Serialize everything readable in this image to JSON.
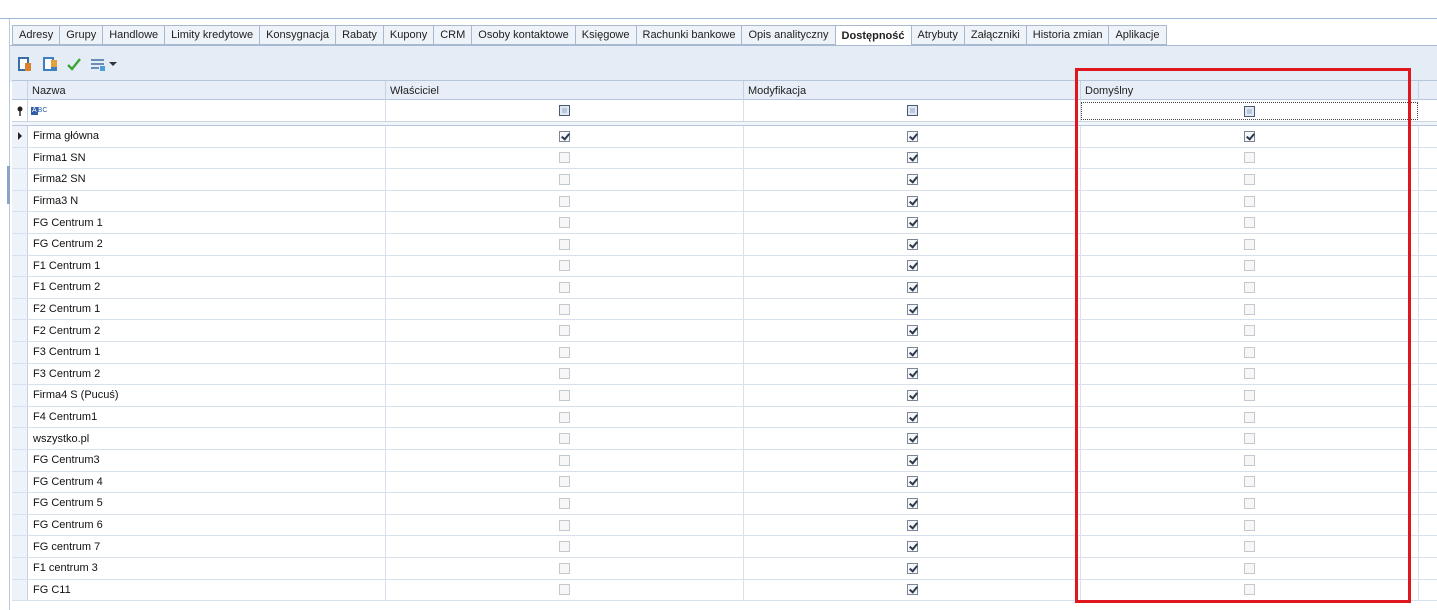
{
  "tabs": [
    {
      "label": "Adresy",
      "active": false
    },
    {
      "label": "Grupy",
      "active": false
    },
    {
      "label": "Handlowe",
      "active": false
    },
    {
      "label": "Limity kredytowe",
      "active": false
    },
    {
      "label": "Konsygnacja",
      "active": false
    },
    {
      "label": "Rabaty",
      "active": false
    },
    {
      "label": "Kupony",
      "active": false
    },
    {
      "label": "CRM",
      "active": false
    },
    {
      "label": "Osoby kontaktowe",
      "active": false
    },
    {
      "label": "Księgowe",
      "active": false
    },
    {
      "label": "Rachunki bankowe",
      "active": false
    },
    {
      "label": "Opis analityczny",
      "active": false
    },
    {
      "label": "Dostępność",
      "active": true
    },
    {
      "label": "Atrybuty",
      "active": false
    },
    {
      "label": "Załączniki",
      "active": false
    },
    {
      "label": "Historia zmian",
      "active": false
    },
    {
      "label": "Aplikacje",
      "active": false
    }
  ],
  "toolbar": {
    "icons": [
      "add-icon",
      "edit-icon",
      "confirm-check-icon",
      "layout-menu-icon",
      "dropdown-arrow-icon"
    ],
    "colors": {
      "add": "#d9822b",
      "edit": "#3f7fc0",
      "check": "#3aa535"
    }
  },
  "grid": {
    "columns": {
      "name": "Nazwa",
      "owner": "Właściciel",
      "modify": "Modyfikacja",
      "default": "Domyślny"
    },
    "filter_row": {
      "name_icon": "text-filter-abc-icon",
      "pin_icon": "pin-icon"
    },
    "rows": [
      {
        "name": "Firma główna",
        "owner": true,
        "modify": true,
        "default": true,
        "current": true
      },
      {
        "name": "Firma1 SN",
        "owner": false,
        "modify": true,
        "default": false
      },
      {
        "name": "Firma2 SN",
        "owner": false,
        "modify": true,
        "default": false
      },
      {
        "name": "Firma3 N",
        "owner": false,
        "modify": true,
        "default": false
      },
      {
        "name": "FG Centrum 1",
        "owner": false,
        "modify": true,
        "default": false
      },
      {
        "name": "FG Centrum 2",
        "owner": false,
        "modify": true,
        "default": false
      },
      {
        "name": "F1 Centrum 1",
        "owner": false,
        "modify": true,
        "default": false
      },
      {
        "name": "F1 Centrum 2",
        "owner": false,
        "modify": true,
        "default": false
      },
      {
        "name": "F2 Centrum 1",
        "owner": false,
        "modify": true,
        "default": false
      },
      {
        "name": "F2 Centrum 2",
        "owner": false,
        "modify": true,
        "default": false
      },
      {
        "name": "F3 Centrum 1",
        "owner": false,
        "modify": true,
        "default": false
      },
      {
        "name": "F3 Centrum 2",
        "owner": false,
        "modify": true,
        "default": false
      },
      {
        "name": "Firma4 S (Pucuś)",
        "owner": false,
        "modify": true,
        "default": false
      },
      {
        "name": "F4 Centrum1",
        "owner": false,
        "modify": true,
        "default": false
      },
      {
        "name": "wszystko.pl",
        "owner": false,
        "modify": true,
        "default": false
      },
      {
        "name": "FG Centrum3",
        "owner": false,
        "modify": true,
        "default": false
      },
      {
        "name": "FG Centrum 4",
        "owner": false,
        "modify": true,
        "default": false
      },
      {
        "name": "FG Centrum 5",
        "owner": false,
        "modify": true,
        "default": false
      },
      {
        "name": "FG Centrum 6",
        "owner": false,
        "modify": true,
        "default": false
      },
      {
        "name": "FG centrum 7",
        "owner": false,
        "modify": true,
        "default": false
      },
      {
        "name": "F1 centrum 3",
        "owner": false,
        "modify": true,
        "default": false
      },
      {
        "name": "FG C11",
        "owner": false,
        "modify": true,
        "default": false
      }
    ]
  },
  "highlight_color": "#e0161e"
}
